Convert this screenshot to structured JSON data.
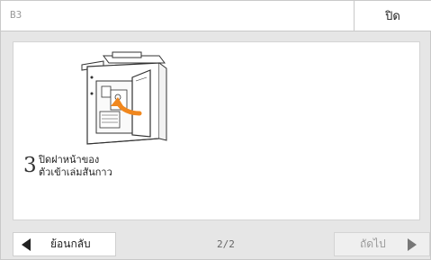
{
  "header": {
    "code": "B3",
    "close_label": "ปิด"
  },
  "step": {
    "number": "3",
    "text_line1": "ปิดฝาหน้าของ",
    "text_line2": "ตัวเข้าเล่มสันกาว"
  },
  "footer": {
    "back_label": "ย้อนกลับ",
    "page_indicator": "2/2",
    "next_label": "ถัดไป"
  },
  "colors": {
    "arrow_accent": "#f0871e",
    "background": "#e6e6e6",
    "panel": "#ffffff"
  },
  "icons": {
    "back": "triangle-left-icon",
    "next": "triangle-right-icon"
  }
}
